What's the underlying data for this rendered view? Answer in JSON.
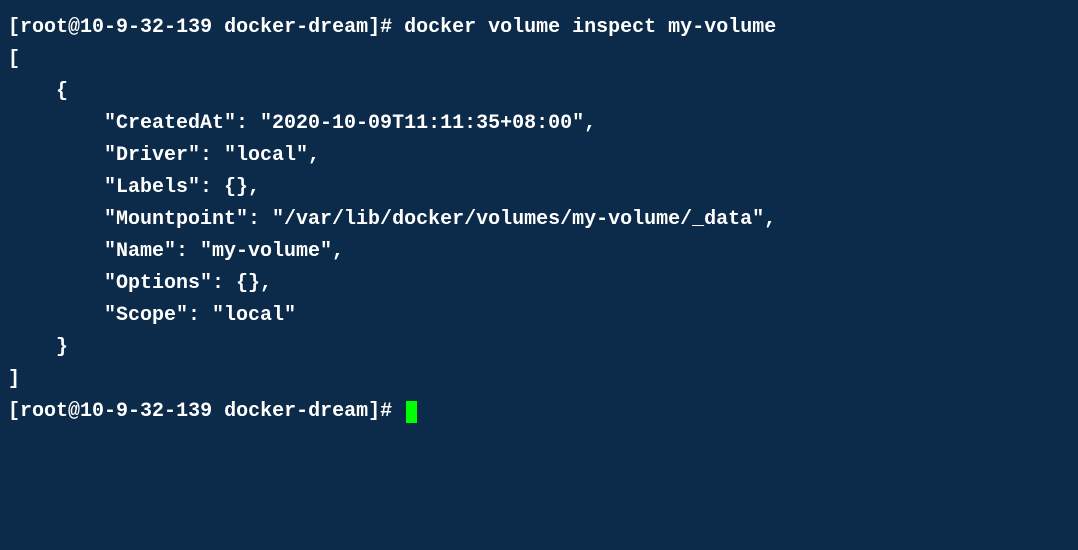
{
  "terminal": {
    "prompt1_user": "root",
    "prompt1_host": "10-9-32-139",
    "prompt1_dir": "docker-dream",
    "command": "docker volume inspect my-volume",
    "output": {
      "open_bracket": "[",
      "open_brace": "    {",
      "field1": "        \"CreatedAt\": \"2020-10-09T11:11:35+08:00\",",
      "field2": "        \"Driver\": \"local\",",
      "field3": "        \"Labels\": {},",
      "field4": "        \"Mountpoint\": \"/var/lib/docker/volumes/my-volume/_data\",",
      "field5": "        \"Name\": \"my-volume\",",
      "field6": "        \"Options\": {},",
      "field7": "        \"Scope\": \"local\"",
      "close_brace": "    }",
      "close_bracket": "]"
    },
    "prompt2_user": "root",
    "prompt2_host": "10-9-32-139",
    "prompt2_dir": "docker-dream"
  }
}
